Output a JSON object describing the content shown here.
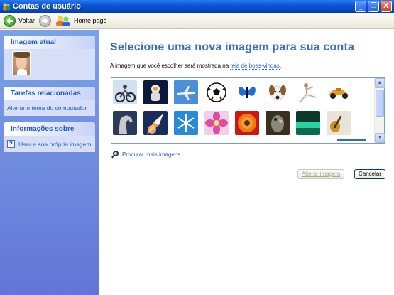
{
  "window": {
    "title": "Contas de usuário",
    "buttons": [
      "_",
      "❐",
      "X"
    ]
  },
  "toolbar": {
    "back_label": "Voltar",
    "home_label": "Home page"
  },
  "sidebar": {
    "current_image": {
      "title": "Imagem atual"
    },
    "related_tasks": {
      "title": "Tarefas relacionadas",
      "items": [
        "Alterar o tema do computador"
      ]
    },
    "about": {
      "title": "Informações sobre",
      "items": [
        "Usar a sua própria imagem"
      ]
    }
  },
  "main": {
    "heading": "Selecione uma nova imagem para sua conta",
    "desc_prefix": "A imagem que você escolher será mostrada na ",
    "desc_link": "tela de boas-vindas",
    "desc_suffix": ".",
    "more_link": "Procurar mais imagens",
    "change_button": "Alterar imagem",
    "cancel_button": "Cancelar"
  },
  "gallery": {
    "pictures": [
      "motorcycle",
      "astronaut",
      "airplane",
      "soccer-ball",
      "butterfly",
      "dog",
      "karate",
      "race-car",
      "horse",
      "rocket-launch",
      "snowflake",
      "pink-flower",
      "orange-flower",
      "parrot",
      "green-landscape",
      "guitar"
    ]
  },
  "colors": {
    "accent": "#3a6fc0",
    "link": "#2a5bd2",
    "sidebar_top": "#7ba2e7",
    "sidebar_bottom": "#6375d6",
    "titlebar": "#0a58d6"
  }
}
